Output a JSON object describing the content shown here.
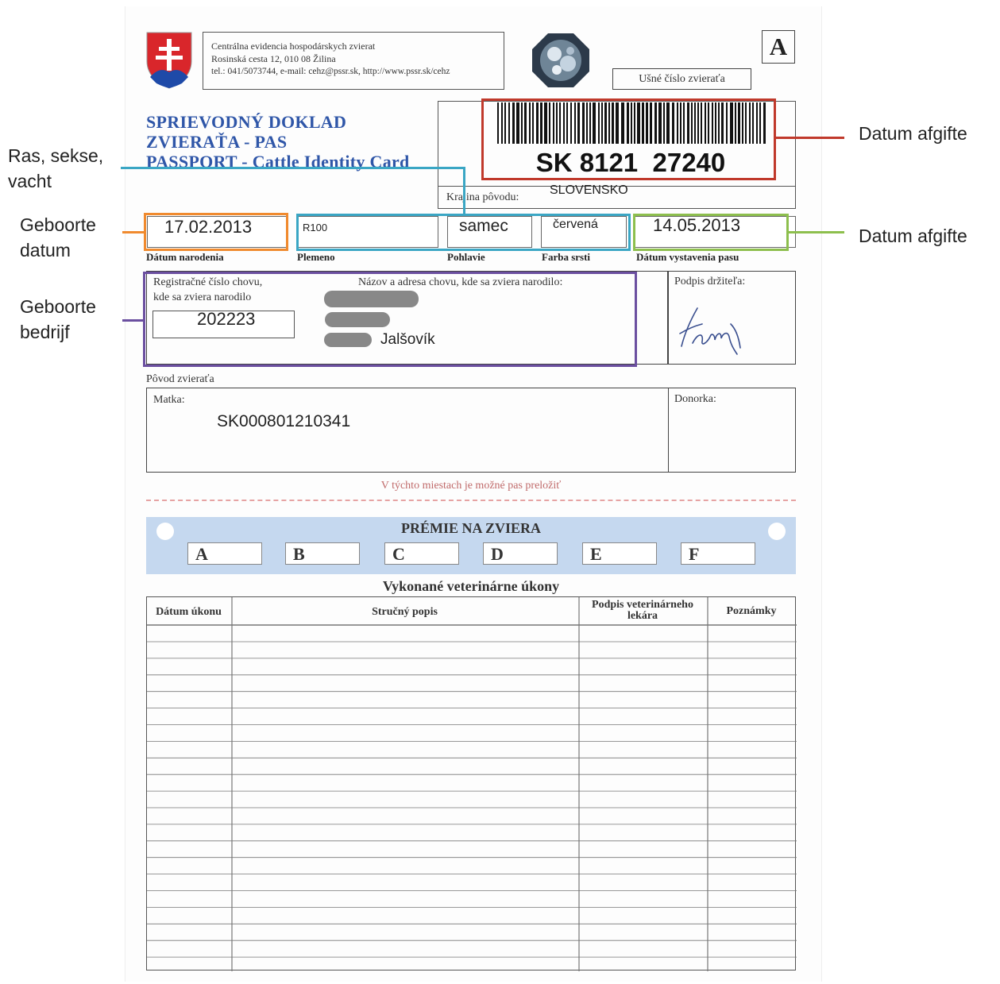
{
  "header": {
    "org_line1": "Centrálna evidencia hospodárskych zvierat",
    "org_line2": "Rosinská cesta 12, 010 08 Žilina",
    "org_line3": "tel.: 041/5073744, e-mail: cehz@pssr.sk, http://www.pssr.sk/cehz",
    "form_letter": "A",
    "ear_tag_label": "Ušné číslo zvieraťa"
  },
  "title": {
    "line1": "SPRIEVODNÝ DOKLAD",
    "line2": "ZVIERAŤA - PAS",
    "line3": "PASSPORT - Cattle Identity Card"
  },
  "id": {
    "number": "SK 8121  27240",
    "country_label": "Krajina pôvodu:",
    "country_value": "SLOVENSKO"
  },
  "fields": {
    "birth_date": "17.02.2013",
    "birth_date_label": "Dátum narodenia",
    "breed": "R100",
    "breed_label": "Plemeno",
    "sex": "samec",
    "sex_label": "Pohlavie",
    "color": "červená",
    "color_label": "Farba srsti",
    "issue_date": "14.05.2013",
    "issue_date_label": "Dátum vystavenia pasu"
  },
  "holding": {
    "reg_label_1": "Registračné číslo chovu,",
    "reg_label_2": "kde sa zviera narodilo",
    "reg_number": "202223",
    "name_label": "Názov a adresa chovu, kde sa zviera narodilo:",
    "place": "Jalšovík",
    "signature_label": "Podpis držiteľa:"
  },
  "origin": {
    "section_label": "Pôvod zvieraťa",
    "mother_label": "Matka:",
    "mother_value": "SK000801210341",
    "donor_label": "Donorka:",
    "fold_note": "V týchto miestach je možné pas preložiť"
  },
  "premiums": {
    "title": "PRÉMIE NA ZVIERA",
    "boxes": [
      "A",
      "B",
      "C",
      "D",
      "E",
      "F"
    ]
  },
  "vet_table": {
    "title": "Vykonané veterinárne úkony",
    "headers": [
      "Dátum úkonu",
      "Stručný popis",
      "Podpis veterinárneho lekára",
      "Poznámky"
    ],
    "header_vet_line1": "Podpis veterinárneho",
    "header_vet_line2": "lekára"
  },
  "annotations": {
    "red": "Datum afgifte",
    "cyan_1": "Ras, sekse,",
    "cyan_2": "vacht",
    "orange_1": "Geboorte",
    "orange_2": "datum",
    "green": "Datum afgifte",
    "purple_1": "Geboorte",
    "purple_2": "bedrijf"
  },
  "colors": {
    "red": "#c0392b",
    "cyan": "#3aa6c4",
    "orange": "#f08a2e",
    "green": "#8dbf4d",
    "purple": "#6b4fa0",
    "title_blue": "#2f56a8",
    "premium_band": "#c5d8ef"
  },
  "icons": [
    "slovak-coat-of-arms-icon",
    "hologram-seal-icon",
    "barcode-icon",
    "signature-icon"
  ]
}
